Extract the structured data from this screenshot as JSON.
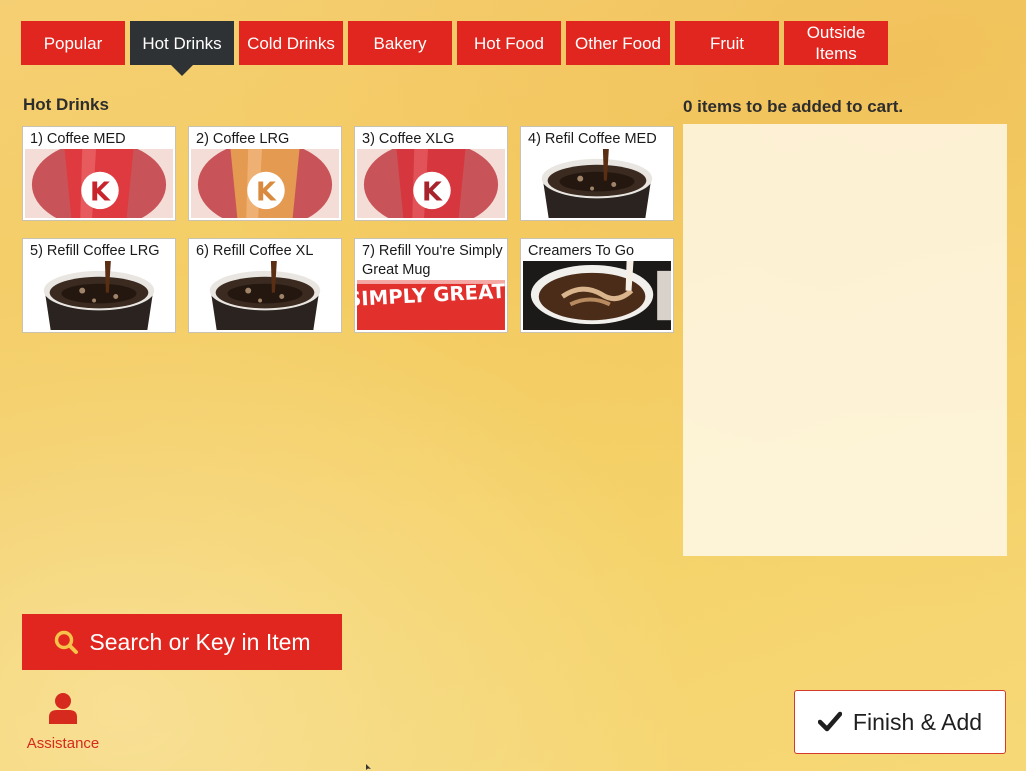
{
  "tabs": [
    {
      "label": "Popular",
      "active": false
    },
    {
      "label": "Hot Drinks",
      "active": true
    },
    {
      "label": "Cold Drinks",
      "active": false
    },
    {
      "label": "Bakery",
      "active": false
    },
    {
      "label": "Hot Food",
      "active": false
    },
    {
      "label": "Other Food",
      "active": false
    },
    {
      "label": "Fruit",
      "active": false
    },
    {
      "label": "Outside Items",
      "active": false
    }
  ],
  "section_title": "Hot Drinks",
  "products": [
    {
      "label": "1) Coffee MED",
      "image": "circle-k-cup-red"
    },
    {
      "label": "2) Coffee LRG",
      "image": "circle-k-cup-orange"
    },
    {
      "label": "3) Coffee XLG",
      "image": "circle-k-cup-red"
    },
    {
      "label": "4) Refil Coffee MED",
      "image": "coffee-pour-cup"
    },
    {
      "label": "5) Refill Coffee LRG",
      "image": "coffee-pour-cup"
    },
    {
      "label": "6) Refill Coffee XL",
      "image": "coffee-pour-cup"
    },
    {
      "label": "7) Refill You're Simply Great Mug",
      "image": "simply-great-mug",
      "image_text": "SIMPLY GREAT!"
    },
    {
      "label": "Creamers To Go",
      "image": "creamer-pour-cup"
    }
  ],
  "cart": {
    "count_text": "0 items to be added to cart.",
    "items": []
  },
  "search_button": {
    "label": "Search or Key in Item",
    "icon": "search-icon"
  },
  "assistance": {
    "label": "Assistance",
    "icon": "user-icon"
  },
  "finish_button": {
    "label": "Finish & Add",
    "icon": "checkmark-icon"
  },
  "colors": {
    "brand_red": "#e0261e",
    "tab_active": "#2f3234",
    "background": "#f4cd63"
  }
}
